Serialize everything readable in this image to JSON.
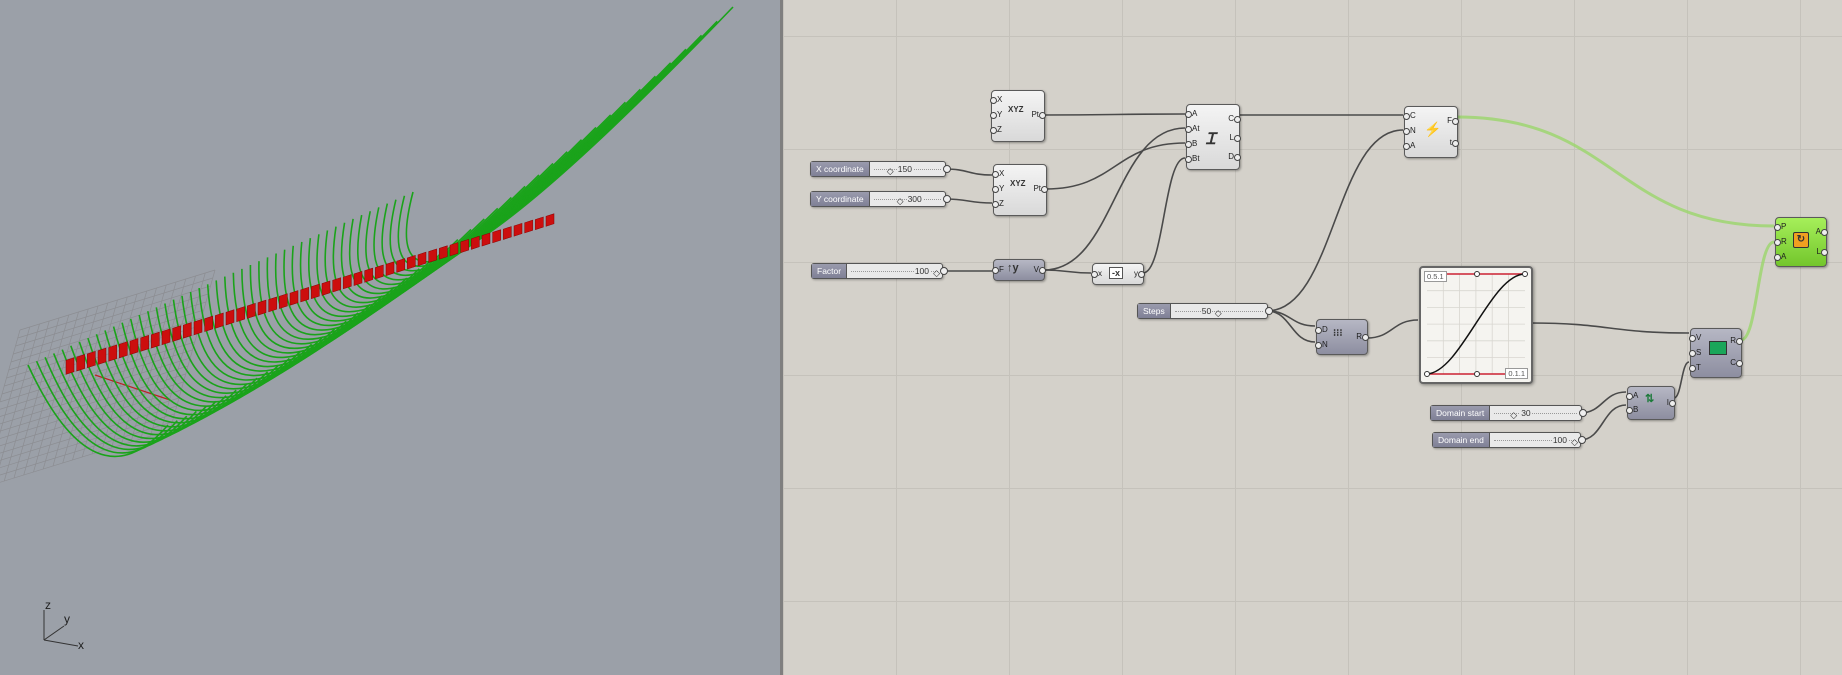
{
  "viewport": {
    "axis_labels": {
      "z": "z",
      "y": "y",
      "x": "x"
    },
    "colors": {
      "background": "#9ba0a8",
      "curves": "#1aa31a",
      "rectangles": "#cc0e0e",
      "grid": "#8d8d90"
    }
  },
  "canvas": {
    "background": "#d4d1ca",
    "sliders": {
      "x_coordinate": {
        "name": "X coordinate",
        "value": "150"
      },
      "y_coordinate": {
        "name": "Y coordinate",
        "value": "300"
      },
      "factor": {
        "name": "Factor",
        "value": "100"
      },
      "steps": {
        "name": "Steps",
        "value": "50"
      },
      "domain_start": {
        "name": "Domain start",
        "value": "30"
      },
      "domain_end": {
        "name": "Domain end",
        "value": "100"
      }
    },
    "components": {
      "point_xyz_1": {
        "inputs": [
          "X",
          "Y",
          "Z"
        ],
        "outputs": [
          "Pt"
        ],
        "icon": "XYZ"
      },
      "point_xyz_2": {
        "inputs": [
          "X",
          "Y",
          "Z"
        ],
        "outputs": [
          "Pt"
        ],
        "icon": "XYZ"
      },
      "arc": {
        "inputs": [
          "A",
          "At",
          "B",
          "Bt"
        ],
        "outputs": [
          "C",
          "L",
          "D"
        ],
        "icon": "arc-icon"
      },
      "unit_y": {
        "inputs": [
          "F"
        ],
        "outputs": [
          "V"
        ],
        "icon": "↑y"
      },
      "negative": {
        "inputs": [
          "x"
        ],
        "outputs": [
          "y"
        ],
        "icon": "-x"
      },
      "curve_frames": {
        "inputs": [
          "C",
          "N",
          "A"
        ],
        "outputs": [
          "F",
          "t"
        ],
        "icon": "frames-icon"
      },
      "range": {
        "inputs": [
          "D",
          "N"
        ],
        "outputs": [
          "R"
        ],
        "icon": "range-icon"
      },
      "remap": {
        "inputs": [
          "V",
          "S",
          "T"
        ],
        "outputs": [
          "R",
          "C"
        ],
        "icon": "remap-icon"
      },
      "construct_domain": {
        "inputs": [
          "A",
          "B"
        ],
        "outputs": [
          "I"
        ],
        "icon": "domain-icon"
      },
      "orient": {
        "inputs": [
          "P",
          "R",
          "A"
        ],
        "outputs": [
          "A",
          "L"
        ],
        "icon": "orient-icon"
      }
    },
    "graph_mapper": {
      "label_top": "0.5.1",
      "label_bottom": "0.1.1"
    }
  }
}
